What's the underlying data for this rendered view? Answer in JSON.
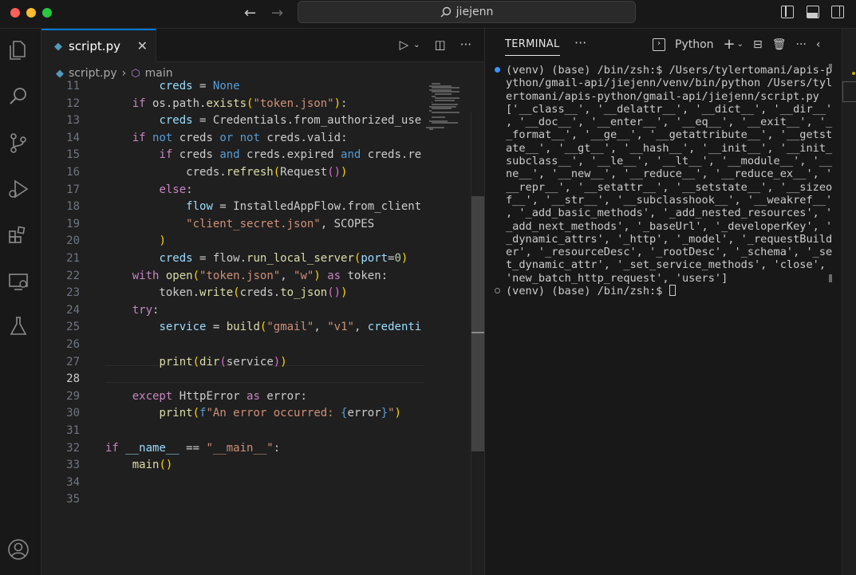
{
  "window": {
    "search_text": "jiejenn"
  },
  "editor": {
    "tab_label": "script.py",
    "breadcrumb_file": "script.py",
    "breadcrumb_symbol": "main",
    "current_line": 28
  },
  "code_lines": [
    {
      "n": "11",
      "tokens": [
        [
          "",
          "        "
        ],
        [
          "var",
          "creds"
        ],
        [
          "",
          " = "
        ],
        [
          "kb",
          "None"
        ]
      ]
    },
    {
      "n": "12",
      "tokens": [
        [
          "",
          "    "
        ],
        [
          "kw",
          "if"
        ],
        [
          "",
          " os.path."
        ],
        [
          "fn",
          "exists"
        ],
        [
          "br1",
          "("
        ],
        [
          "str",
          "\"token.json\""
        ],
        [
          "br1",
          ")"
        ],
        [
          "",
          ":"
        ]
      ]
    },
    {
      "n": "13",
      "tokens": [
        [
          "",
          "        "
        ],
        [
          "var",
          "creds"
        ],
        [
          "",
          " = Credentials.from_authorized_use"
        ]
      ]
    },
    {
      "n": "14",
      "tokens": [
        [
          "",
          "    "
        ],
        [
          "kw",
          "if"
        ],
        [
          "",
          " "
        ],
        [
          "kb",
          "not"
        ],
        [
          "",
          " creds "
        ],
        [
          "kb",
          "or"
        ],
        [
          "",
          " "
        ],
        [
          "kb",
          "not"
        ],
        [
          "",
          " creds.valid:"
        ]
      ]
    },
    {
      "n": "15",
      "tokens": [
        [
          "",
          "        "
        ],
        [
          "kw",
          "if"
        ],
        [
          "",
          " creds "
        ],
        [
          "kb",
          "and"
        ],
        [
          "",
          " creds.expired "
        ],
        [
          "kb",
          "and"
        ],
        [
          "",
          " creds.re"
        ]
      ]
    },
    {
      "n": "16",
      "tokens": [
        [
          "",
          "            creds."
        ],
        [
          "fn",
          "refresh"
        ],
        [
          "br1",
          "("
        ],
        [
          "",
          "Request"
        ],
        [
          "br2",
          "()"
        ],
        [
          "br1",
          ")"
        ]
      ]
    },
    {
      "n": "17",
      "tokens": [
        [
          "",
          "        "
        ],
        [
          "kw",
          "else"
        ],
        [
          "",
          ":"
        ]
      ]
    },
    {
      "n": "18",
      "tokens": [
        [
          "",
          "            "
        ],
        [
          "var",
          "flow"
        ],
        [
          "",
          " = InstalledAppFlow.from_client"
        ]
      ]
    },
    {
      "n": "19",
      "tokens": [
        [
          "",
          "            "
        ],
        [
          "str",
          "\"client_secret.json\""
        ],
        [
          "",
          ", SCOPES"
        ]
      ]
    },
    {
      "n": "20",
      "tokens": [
        [
          "",
          "        "
        ],
        [
          "br1",
          ")"
        ]
      ]
    },
    {
      "n": "21",
      "tokens": [
        [
          "",
          "        "
        ],
        [
          "var",
          "creds"
        ],
        [
          "",
          " = flow."
        ],
        [
          "fn",
          "run_local_server"
        ],
        [
          "br1",
          "("
        ],
        [
          "var",
          "port"
        ],
        [
          "",
          "="
        ],
        [
          "num",
          "0"
        ],
        [
          "br1",
          ")"
        ]
      ]
    },
    {
      "n": "22",
      "tokens": [
        [
          "",
          "    "
        ],
        [
          "kw",
          "with"
        ],
        [
          "",
          " "
        ],
        [
          "fn",
          "open"
        ],
        [
          "br1",
          "("
        ],
        [
          "str",
          "\"token.json\""
        ],
        [
          "",
          ", "
        ],
        [
          "str",
          "\"w\""
        ],
        [
          "br1",
          ")"
        ],
        [
          "",
          " "
        ],
        [
          "kw",
          "as"
        ],
        [
          "",
          " token:"
        ]
      ]
    },
    {
      "n": "23",
      "tokens": [
        [
          "",
          "        token."
        ],
        [
          "fn",
          "write"
        ],
        [
          "br1",
          "("
        ],
        [
          "",
          "creds."
        ],
        [
          "fn",
          "to_json"
        ],
        [
          "br2",
          "()"
        ],
        [
          "br1",
          ")"
        ]
      ]
    },
    {
      "n": "24",
      "tokens": [
        [
          "",
          "    "
        ],
        [
          "kw",
          "try"
        ],
        [
          "",
          ":"
        ]
      ]
    },
    {
      "n": "25",
      "tokens": [
        [
          "",
          "        "
        ],
        [
          "var",
          "service"
        ],
        [
          "",
          " = "
        ],
        [
          "fn",
          "build"
        ],
        [
          "br1",
          "("
        ],
        [
          "str",
          "\"gmail\""
        ],
        [
          "",
          ", "
        ],
        [
          "str",
          "\"v1\""
        ],
        [
          "",
          ", "
        ],
        [
          "var",
          "credenti"
        ]
      ]
    },
    {
      "n": "26",
      "tokens": [
        [
          "",
          ""
        ]
      ]
    },
    {
      "n": "27",
      "tokens": [
        [
          "",
          "        "
        ],
        [
          "fn",
          "print"
        ],
        [
          "br1",
          "("
        ],
        [
          "fn",
          "dir"
        ],
        [
          "br2",
          "("
        ],
        [
          "",
          "service"
        ],
        [
          "br2",
          ")"
        ],
        [
          "br1",
          ")"
        ]
      ]
    },
    {
      "n": "28",
      "tokens": [
        [
          "",
          ""
        ]
      ]
    },
    {
      "n": "29",
      "tokens": [
        [
          "",
          "    "
        ],
        [
          "kw",
          "except"
        ],
        [
          "",
          " HttpError "
        ],
        [
          "kw",
          "as"
        ],
        [
          "",
          " error:"
        ]
      ]
    },
    {
      "n": "30",
      "tokens": [
        [
          "",
          "        "
        ],
        [
          "fn",
          "print"
        ],
        [
          "br1",
          "("
        ],
        [
          "kb",
          "f"
        ],
        [
          "str",
          "\"An error occurred: "
        ],
        [
          "kb",
          "{"
        ],
        [
          "",
          "error"
        ],
        [
          "kb",
          "}"
        ],
        [
          "str",
          "\""
        ],
        [
          "br1",
          ")"
        ]
      ]
    },
    {
      "n": "31",
      "tokens": [
        [
          "",
          ""
        ]
      ]
    },
    {
      "n": "32",
      "tokens": [
        [
          "kw",
          "if"
        ],
        [
          "",
          " "
        ],
        [
          "var",
          "__name__"
        ],
        [
          "",
          " == "
        ],
        [
          "str",
          "\"__main__\""
        ],
        [
          "",
          ":"
        ]
      ]
    },
    {
      "n": "33",
      "tokens": [
        [
          "",
          "    "
        ],
        [
          "fn",
          "main"
        ],
        [
          "br1",
          "()"
        ]
      ]
    },
    {
      "n": "34",
      "tokens": [
        [
          "",
          ""
        ]
      ]
    },
    {
      "n": "35",
      "tokens": [
        [
          "",
          ""
        ]
      ]
    }
  ],
  "terminal": {
    "tab_label": "TERMINAL",
    "shell_label": "Python",
    "block1": [
      "(venv) (base) /bin/zsh:$ /Users/tylertomani/apis-p",
      "ython/gmail-api/jiejenn/venv/bin/python /Users/tyl",
      "ertomani/apis-python/gmail-api/jiejenn/script.py",
      "['__class__', '__delattr__', '__dict__', '__dir__'",
      ", '__doc__', '__enter__', '__eq__', '__exit__', '_",
      "_format__', '__ge__', '__getattribute__', '__getst",
      "ate__', '__gt__', '__hash__', '__init__', '__init_",
      "subclass__', '__le__', '__lt__', '__module__', '__",
      "ne__', '__new__', '__reduce__', '__reduce_ex__', '",
      "__repr__', '__setattr__', '__setstate__', '__sizeo",
      "f__', '__str__', '__subclasshook__', '__weakref__'",
      ", '_add_basic_methods', '_add_nested_resources', '",
      "_add_next_methods', '_baseUrl', '_developerKey', '",
      "_dynamic_attrs', '_http', '_model', '_requestBuild",
      "er', '_resourceDesc', '_rootDesc', '_schema', '_se",
      "t_dynamic_attr', '_set_service_methods', 'close',",
      "'new_batch_http_request', 'users']"
    ],
    "prompt": "(venv) (base) /bin/zsh:$ "
  }
}
